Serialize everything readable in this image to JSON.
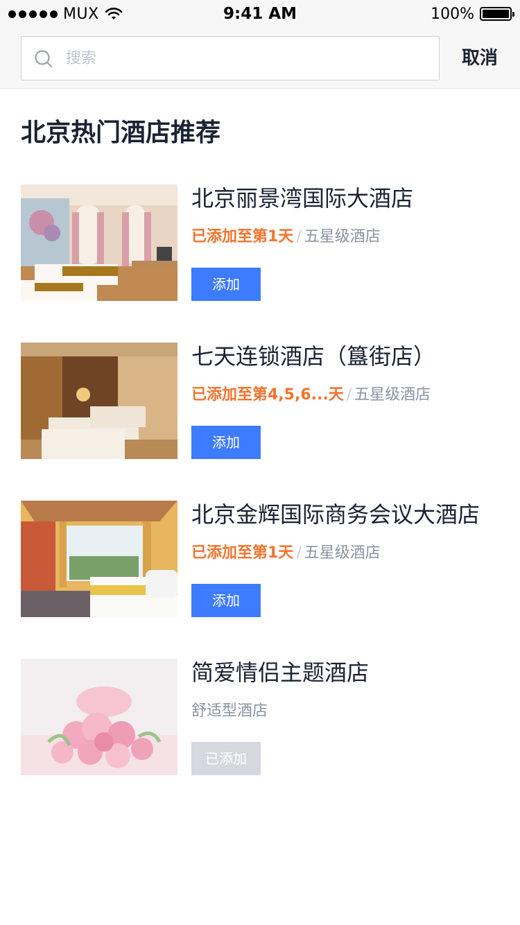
{
  "status_bar": {
    "carrier": "MUX",
    "time": "9:41 AM",
    "battery": "100%"
  },
  "search": {
    "placeholder": "搜索",
    "value": "",
    "cancel_label": "取消"
  },
  "section_title": "北京热门酒店推荐",
  "hotels": [
    {
      "name": "北京丽景湾国际大酒店",
      "added_text": "已添加至第1天",
      "separator": "/",
      "type": "五星级酒店",
      "button": "添加",
      "image": "hotel-room-photo"
    },
    {
      "name": "七天连锁酒店（簋街店）",
      "added_text": "已添加至第4,5,6...天",
      "separator": "/",
      "type": "五星级酒店",
      "button": "添加",
      "image": "hotel-room-photo"
    },
    {
      "name": "北京金辉国际商务会议大酒店",
      "added_text": "已添加至第1天",
      "separator": "/",
      "type": "五星级酒店",
      "button": "添加",
      "image": "hotel-room-photo"
    },
    {
      "name": "简爱情侣主题酒店",
      "added_text": "",
      "separator": "",
      "type": "舒适型酒店",
      "button": "已添加",
      "image": "flower-bouquet-photo"
    }
  ],
  "colors": {
    "accent": "#3d7bff",
    "added_orange": "#f5732b",
    "meta_grey": "#8a93a3",
    "disabled": "#d5d8de"
  }
}
